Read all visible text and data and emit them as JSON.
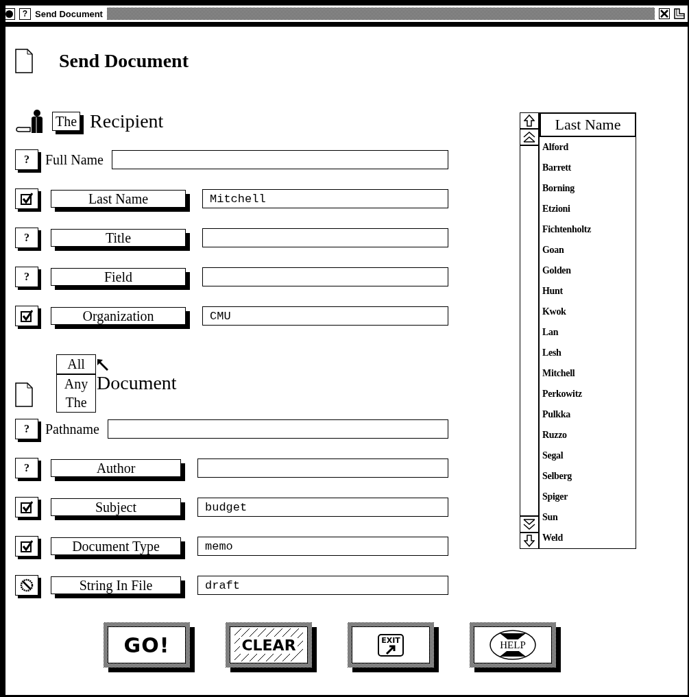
{
  "window": {
    "title": "Send Document",
    "help_button": "?"
  },
  "heading": "Send Document",
  "recipient": {
    "determiner": "The",
    "title": "Recipient",
    "fields": [
      {
        "kind": "unknown",
        "mark": "?",
        "boxed_label": false,
        "label": "Full Name"
      },
      {
        "kind": "included",
        "boxed_label": true,
        "label": "Last Name",
        "value": "Mitchell"
      },
      {
        "kind": "unknown",
        "mark": "?",
        "boxed_label": true,
        "label": "Title"
      },
      {
        "kind": "unknown",
        "mark": "?",
        "boxed_label": true,
        "label": "Field"
      },
      {
        "kind": "included",
        "boxed_label": true,
        "label": "Organization",
        "value": "CMU"
      }
    ]
  },
  "document": {
    "determiners": [
      {
        "label": "All",
        "selected": true
      },
      {
        "label": "Any",
        "selected": false
      },
      {
        "label": "The",
        "selected": false
      }
    ],
    "title": "Document",
    "fields": [
      {
        "kind": "unknown",
        "mark": "?",
        "boxed_label": false,
        "label": "Pathname"
      },
      {
        "kind": "unknown",
        "mark": "?",
        "boxed_label": true,
        "label": "Author"
      },
      {
        "kind": "included",
        "boxed_label": true,
        "label": "Subject",
        "value": "budget"
      },
      {
        "kind": "included",
        "boxed_label": true,
        "label": "Document Type",
        "value": "memo"
      },
      {
        "kind": "excluded",
        "boxed_label": true,
        "label": "String In File",
        "value": "draft"
      }
    ]
  },
  "name_list": {
    "header": "Last Name",
    "items": [
      "Alford",
      "Barrett",
      "Borning",
      "Etzioni",
      "Fichtenholtz",
      "Goan",
      "Golden",
      "Hunt",
      "Kwok",
      "Lan",
      "Lesh",
      "Mitchell",
      "Perkowitz",
      "Pulkka",
      "Ruzzo",
      "Segal",
      "Selberg",
      "Spiger",
      "Sun",
      "Weld"
    ]
  },
  "buttons": [
    {
      "kind": "go",
      "label": "GO!"
    },
    {
      "kind": "clear",
      "label": "CLEAR"
    },
    {
      "kind": "exit",
      "label": "EXIT"
    },
    {
      "kind": "help",
      "label": "HELP"
    }
  ]
}
